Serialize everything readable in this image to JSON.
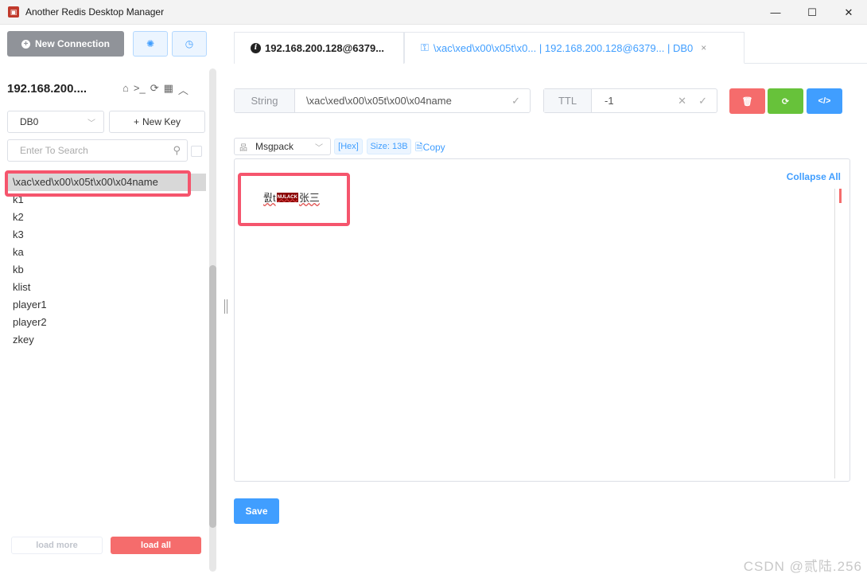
{
  "window": {
    "title": "Another Redis Desktop Manager",
    "minimize": "—",
    "maximize": "☐",
    "close": "✕"
  },
  "sidebar": {
    "new_connection": "New Connection",
    "connection_name": "192.168.200....",
    "db_select": "DB0",
    "new_key": "New Key",
    "search_placeholder": "Enter To Search",
    "keys": [
      "\\xac\\xed\\x00\\x05t\\x00\\x04name",
      "k1",
      "k2",
      "k3",
      "ka",
      "kb",
      "klist",
      "player1",
      "player2",
      "zkey"
    ],
    "load_more": "load more",
    "load_all": "load all"
  },
  "tabs": [
    {
      "label": "192.168.200.128@6379...",
      "icon": "info-icon"
    },
    {
      "label": "\\xac\\xed\\x00\\x05t\\x0... | 192.168.200.128@6379... | DB0",
      "icon": "key-icon",
      "close": "×"
    }
  ],
  "key_detail": {
    "type_label": "String",
    "key_name": "\\xac\\xed\\x00\\x05t\\x00\\x04name",
    "ttl_label": "TTL",
    "ttl_value": "-1",
    "format": "Msgpack",
    "hex_tag": "[Hex]",
    "size_tag": "Size: 13B",
    "copy": "Copy",
    "collapse_all": "Collapse All",
    "value_prefix": "뤐t",
    "value_control": "NULACK",
    "value_suffix": "张三",
    "save": "Save"
  },
  "colors": {
    "primary": "#409eff",
    "danger": "#f56c6c",
    "success": "#67c23a",
    "highlight": "#f5556d"
  },
  "watermark": "CSDN @贰陆.256"
}
